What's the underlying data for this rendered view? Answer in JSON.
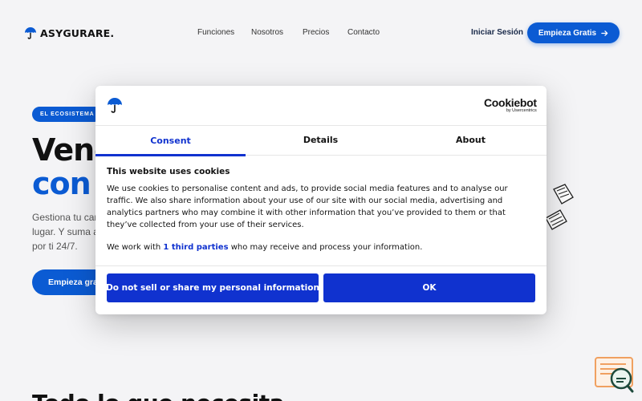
{
  "header": {
    "brand": "ASYGURARE.",
    "nav": [
      {
        "label": "Funciones"
      },
      {
        "label": "Nosotros"
      },
      {
        "label": "Precios"
      },
      {
        "label": "Contacto"
      }
    ],
    "login_label": "Iniciar Sesión",
    "cta_label": "Empieza Gratis",
    "cta_icon": "arrow-right-icon"
  },
  "hero": {
    "badge": "EL ECOSISTEMA",
    "title_line1": "Venc",
    "title_line2": "con s",
    "description_lines": [
      "Gestiona tu car",
      "lugar. Y suma a",
      "por ti 24/7."
    ],
    "cta_label": "Empieza grat"
  },
  "section": {
    "title": "Todo lo que necesita"
  },
  "cookie_dialog": {
    "provider_name": "Cookiebot",
    "provider_sub": "by Usercentrics",
    "tabs": [
      {
        "label": "Consent",
        "active": true
      },
      {
        "label": "Details",
        "active": false
      },
      {
        "label": "About",
        "active": false
      }
    ],
    "heading": "This website uses cookies",
    "body_lines": [
      "We use cookies to personalise content and ads, to provide social media features and to analyse our",
      "traffic. We also share information about your use of our site with our social media, advertising and",
      "analytics partners who may combine it with other information that you’ve provided to them or that",
      "they’ve collected from your use of their services."
    ],
    "parties_prefix": "We work with ",
    "parties_link": "1 third parties",
    "parties_suffix": " who may receive and process your information.",
    "deny_button": "Do not sell or share my personal information",
    "ok_button": "OK"
  },
  "colors": {
    "brand_blue": "#0b5bd3",
    "cookiebot_blue": "#1032cf",
    "widget_orange": "#f0a060"
  }
}
